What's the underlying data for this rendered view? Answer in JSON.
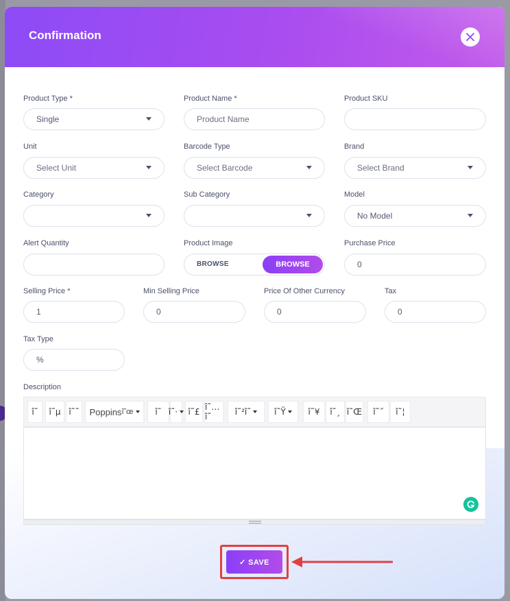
{
  "modal": {
    "title": "Confirmation",
    "close_icon": "close-icon"
  },
  "form": {
    "product_type": {
      "label": "Product Type *",
      "value": "Single"
    },
    "product_name": {
      "label": "Product Name *",
      "placeholder": "Product Name"
    },
    "product_sku": {
      "label": "Product SKU",
      "value": ""
    },
    "unit": {
      "label": "Unit",
      "value": "Select Unit"
    },
    "barcode_type": {
      "label": "Barcode Type",
      "value": "Select Barcode"
    },
    "brand": {
      "label": "Brand",
      "value": "Select Brand"
    },
    "category": {
      "label": "Category",
      "value": ""
    },
    "sub_category": {
      "label": "Sub Category",
      "value": ""
    },
    "model": {
      "label": "Model",
      "value": "No Model"
    },
    "alert_quantity": {
      "label": "Alert Quantity",
      "value": ""
    },
    "product_image": {
      "label": "Product Image",
      "browse_text": "BROWSE",
      "browse_button": "BROWSE"
    },
    "purchase_price": {
      "label": "Purchase Price",
      "value": "0"
    },
    "selling_price": {
      "label": "Selling Price *",
      "value": "1"
    },
    "min_selling_price": {
      "label": "Min Selling Price",
      "value": "0"
    },
    "price_other_currency": {
      "label": "Price Of Other Currency",
      "value": "0"
    },
    "tax": {
      "label": "Tax",
      "value": "0"
    },
    "tax_type": {
      "label": "Tax Type",
      "value": "%"
    },
    "description": {
      "label": "Description"
    }
  },
  "toolbar": {
    "buttons": [
      "î˜",
      "î˜µ",
      "î˜˜",
      "î˜œ",
      "î˜",
      "î˜·",
      "î˜£",
      "î˜…î˜",
      "î˜²î˜",
      "î˜Ÿ",
      "î˜¥",
      "î˜¸",
      "î˜Œ",
      "î˜˝",
      "î˜¦"
    ],
    "font_family": "Poppins"
  },
  "footer": {
    "save_label": "✓ SAVE"
  },
  "colors": {
    "accent": "#8a3ff7",
    "accent_end": "#b24ce9",
    "highlight": "#e04040",
    "grammarly": "#15c39a"
  }
}
